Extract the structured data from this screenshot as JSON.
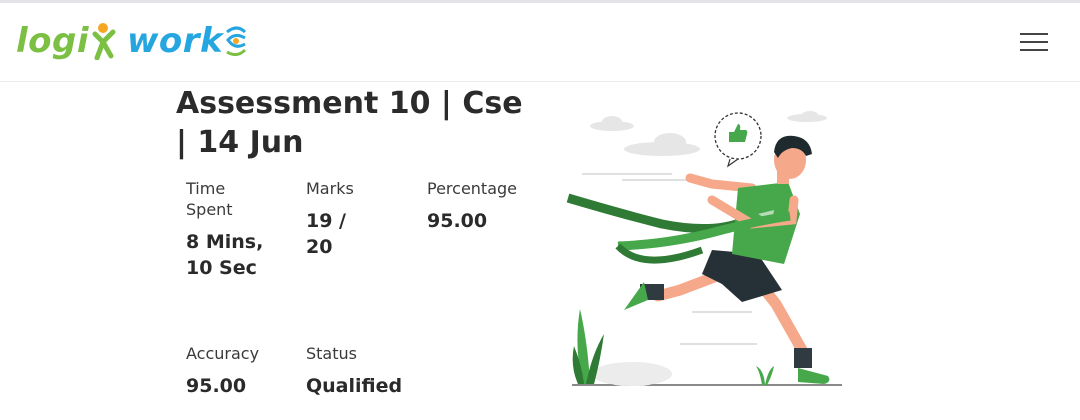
{
  "header": {
    "logo_text_left": "logi",
    "logo_text_right": "work",
    "menu_icon": "hamburger-menu-icon"
  },
  "assessment": {
    "title": "Assessment 10 | Cse | 14 Jun"
  },
  "stats": {
    "time_spent": {
      "label": "Time Spent",
      "value": "8 Mins, 10 Sec"
    },
    "marks": {
      "label": "Marks",
      "value": "19 / 20"
    },
    "percentage": {
      "label": "Percentage",
      "value": "95.00"
    },
    "accuracy": {
      "label": "Accuracy",
      "value": "95.00"
    },
    "status": {
      "label": "Status",
      "value": "Qualified"
    }
  },
  "colors": {
    "logo_green": "#7cc043",
    "logo_blue": "#26a6e0",
    "illustration_green": "#46a84a",
    "text_dark": "#2a2a2a"
  }
}
